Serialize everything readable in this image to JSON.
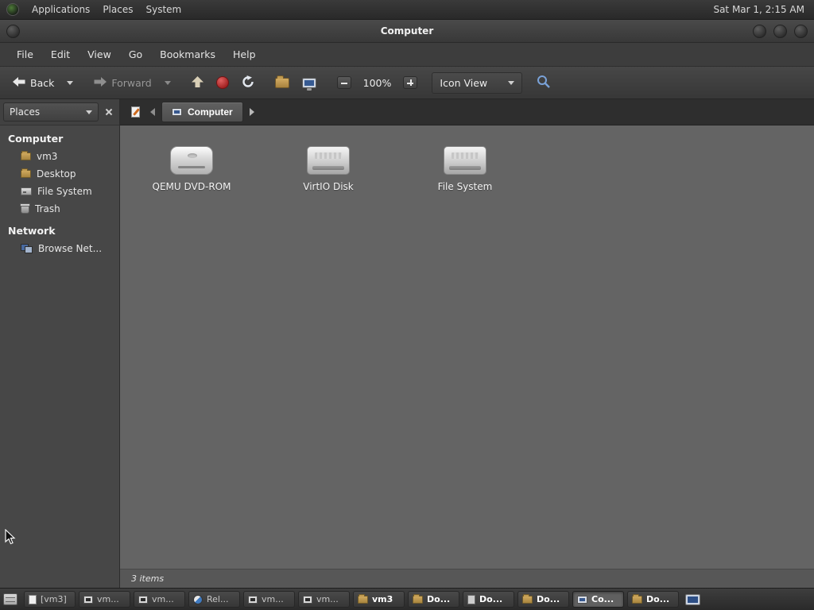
{
  "colors": {
    "accent_blue": "#6f9bd6",
    "stop_red": "#b83030",
    "folder_tan": "#c0984f"
  },
  "top_panel": {
    "menu_applications": "Applications",
    "menu_places": "Places",
    "menu_system": "System",
    "clock": "Sat Mar 1, 2:15 AM"
  },
  "window": {
    "title": "Computer",
    "menubar": {
      "file": "File",
      "edit": "Edit",
      "view": "View",
      "go": "Go",
      "bookmarks": "Bookmarks",
      "help": "Help"
    },
    "toolbar": {
      "back_label": "Back",
      "forward_label": "Forward",
      "zoom_level": "100%",
      "view_mode": "Icon View"
    },
    "sidebar": {
      "selector_label": "Places",
      "section1_header": "Computer",
      "items": [
        {
          "label": "vm3",
          "icon": "folder"
        },
        {
          "label": "Desktop",
          "icon": "folder"
        },
        {
          "label": "File System",
          "icon": "drive"
        },
        {
          "label": "Trash",
          "icon": "trash"
        }
      ],
      "section2_header": "Network",
      "network_items": [
        {
          "label": "Browse Net...",
          "icon": "network"
        }
      ]
    },
    "pathbar": {
      "current": "Computer"
    },
    "content": {
      "items": [
        {
          "label": "QEMU DVD-ROM",
          "icon": "optical"
        },
        {
          "label": "VirtIO Disk",
          "icon": "disk"
        },
        {
          "label": "File System",
          "icon": "disk"
        }
      ]
    },
    "status": "3 items"
  },
  "taskbar": {
    "items": [
      {
        "label": "[vm3]",
        "icon": "page",
        "bold": false
      },
      {
        "label": "vm...",
        "icon": "vm",
        "bold": false
      },
      {
        "label": "vm...",
        "icon": "vm",
        "bold": false
      },
      {
        "label": "Rel...",
        "icon": "remmina",
        "bold": false
      },
      {
        "label": "vm...",
        "icon": "terminal",
        "bold": false
      },
      {
        "label": "vm...",
        "icon": "terminal",
        "bold": false
      },
      {
        "label": "vm3",
        "icon": "folder",
        "bold": true
      },
      {
        "label": "Do...",
        "icon": "folder",
        "bold": true
      },
      {
        "label": "Do...",
        "icon": "document",
        "bold": true
      },
      {
        "label": "Do...",
        "icon": "folder",
        "bold": true
      },
      {
        "label": "Co...",
        "icon": "computer",
        "bold": true,
        "active": true
      },
      {
        "label": "Do...",
        "icon": "folder",
        "bold": true
      }
    ]
  }
}
